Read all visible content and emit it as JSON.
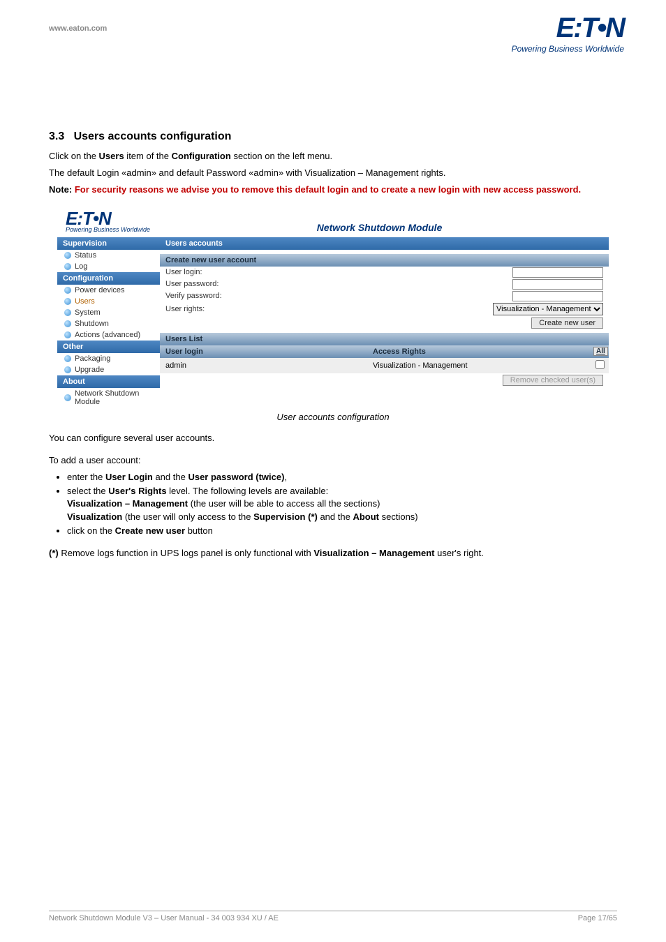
{
  "header": {
    "url": "www.eaton.com",
    "brand": "E:T•N",
    "tagline": "Powering Business Worldwide"
  },
  "section": {
    "number": "3.3",
    "title": "Users accounts configuration",
    "intro_a": "Click on the ",
    "intro_b": "Users",
    "intro_c": " item of the ",
    "intro_d": "Configuration",
    "intro_e": " section on the left menu.",
    "p2": "The default Login «admin» and default Password «admin» with Visualization – Management rights.",
    "note_label": "Note: ",
    "note_text": "For security reasons we advise you to remove this default login and to create a new login with new access password."
  },
  "screenshot": {
    "app_title": "Network  Shutdown  Module",
    "brand": "E:T•N",
    "tagline": "Powering Business Worldwide",
    "side": {
      "cats": [
        "Supervision",
        "Configuration",
        "Other",
        "About"
      ],
      "supervision": [
        "Status",
        "Log"
      ],
      "configuration": [
        "Power devices",
        "Users",
        "System",
        "Shutdown",
        "Actions (advanced)"
      ],
      "other": [
        "Packaging",
        "Upgrade"
      ],
      "about": [
        "Network Shutdown Module"
      ]
    },
    "main": {
      "title": "Users accounts",
      "create_title": "Create new user account",
      "labels": {
        "login": "User login:",
        "password": "User password:",
        "verify": "Verify password:",
        "rights": "User rights:"
      },
      "rights_option": "Visualization - Management",
      "create_button": "Create new user",
      "list_title": "Users List",
      "col_login": "User login",
      "col_rights": "Access Rights",
      "col_all": "All",
      "row_login": "admin",
      "row_rights": "Visualization - Management",
      "remove_button": "Remove checked user(s)"
    },
    "caption": "User accounts configuration"
  },
  "after": {
    "p1": "You can configure several user accounts.",
    "p2": "To add a user account:",
    "b1a": "enter the ",
    "b1b": "User Login",
    "b1c": " and the ",
    "b1d": "User password (twice)",
    "b1e": ",",
    "b2a": "select the ",
    "b2b": "User's Rights",
    "b2c": " level. The following levels are available:",
    "b2l1a": "Visualization – Management",
    "b2l1b": " (the user will be able to access all the sections)",
    "b2l2a": "Visualization",
    "b2l2b": " (the user will only access to the ",
    "b2l2c": "Supervision (*)",
    "b2l2d": " and the ",
    "b2l2e": "About",
    "b2l2f": " sections)",
    "b3a": "click on the ",
    "b3b": "Create new user",
    "b3c": " button",
    "star_a": "(*)",
    "star_b": " Remove logs function in UPS logs panel is only functional with ",
    "star_c": "Visualization – Management",
    "star_d": " user's right."
  },
  "footer": {
    "left": "Network Shutdown Module V3 – User Manual - 34 003 934 XU / AE",
    "right": "Page 17/65"
  }
}
